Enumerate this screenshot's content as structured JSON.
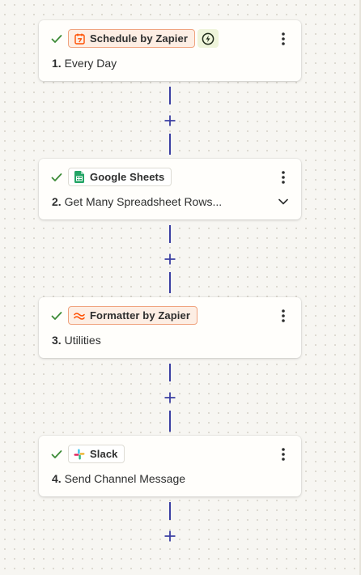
{
  "steps": [
    {
      "app": "Schedule by Zapier",
      "number": "1.",
      "title": "Every Day",
      "app_icon": "calendar-icon",
      "app_color": "#ff4f00",
      "status": "complete",
      "has_trigger_bolt": true,
      "has_chevron": false
    },
    {
      "app": "Google Sheets",
      "number": "2.",
      "title": "Get Many Spreadsheet Rows...",
      "app_icon": "google-sheets-icon",
      "app_color": "#23a566",
      "status": "complete",
      "has_trigger_bolt": false,
      "has_chevron": true
    },
    {
      "app": "Formatter by Zapier",
      "number": "3.",
      "title": "Utilities",
      "app_icon": "formatter-icon",
      "app_color": "#ff4f00",
      "status": "complete",
      "has_trigger_bolt": false,
      "has_chevron": false
    },
    {
      "app": "Slack",
      "number": "4.",
      "title": "Send Channel Message",
      "app_icon": "slack-icon",
      "app_color": "#4a154b",
      "status": "complete",
      "has_trigger_bolt": false,
      "has_chevron": false
    }
  ],
  "colors": {
    "check": "#3d8b37",
    "connector": "#3b3fa3",
    "badge_border_orange": "#f0a37e"
  },
  "icons": [
    "check-icon",
    "more-vertical-icon",
    "bolt-icon",
    "chevron-down-icon",
    "plus-icon"
  ]
}
